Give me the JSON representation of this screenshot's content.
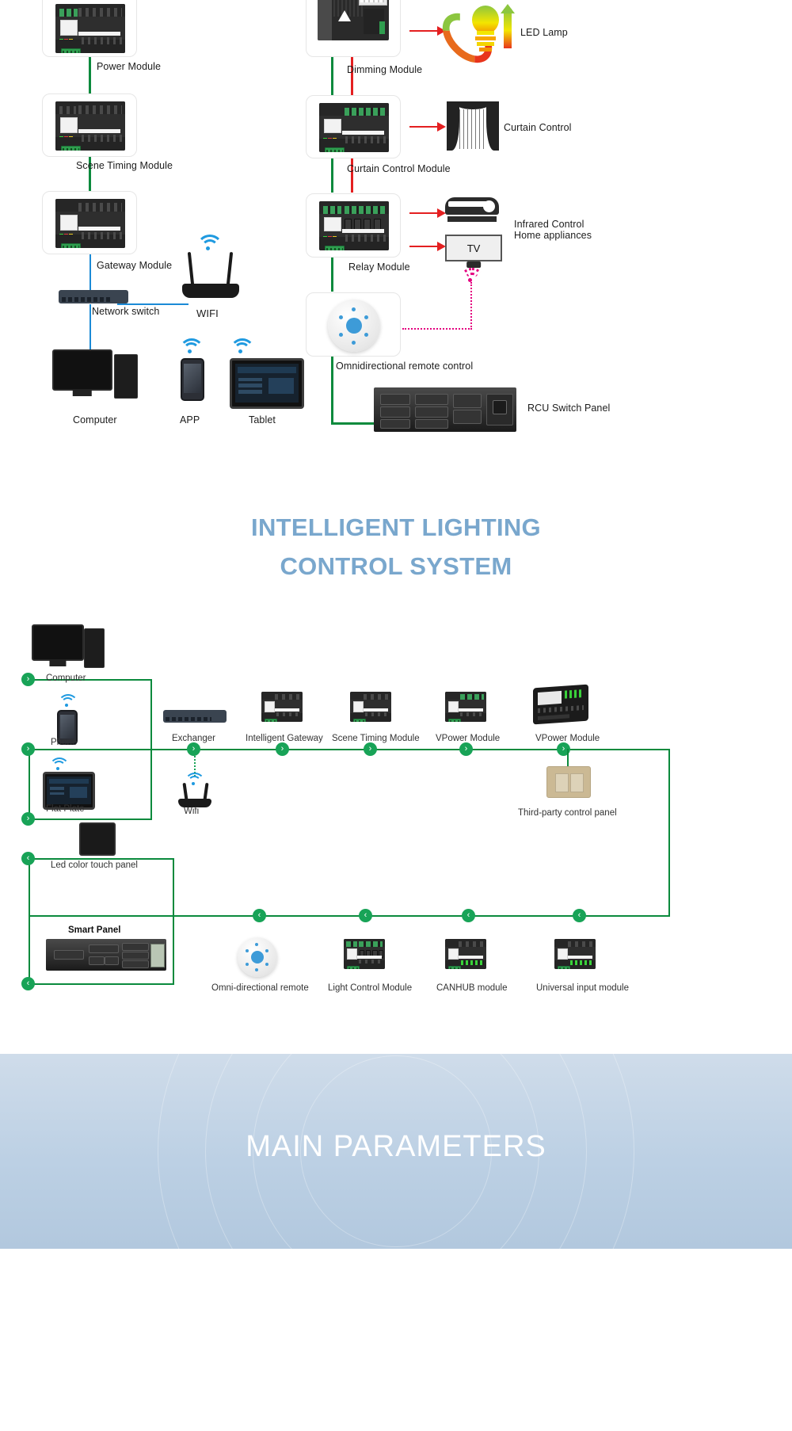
{
  "diagram_top": {
    "name": "hotel-rcu-system-topology",
    "nodes": [
      {
        "id": "power_module",
        "label": "Power Module"
      },
      {
        "id": "scene_timing_module",
        "label": "Scene Timing Module"
      },
      {
        "id": "gateway_module",
        "label": "Gateway Module"
      },
      {
        "id": "network_switch",
        "label": "Network switch"
      },
      {
        "id": "wifi",
        "label": "WIFI"
      },
      {
        "id": "computer",
        "label": "Computer"
      },
      {
        "id": "app",
        "label": "APP"
      },
      {
        "id": "tablet",
        "label": "Tablet"
      },
      {
        "id": "dimming_module",
        "label": "Dimming Module"
      },
      {
        "id": "curtain_control_module",
        "label": "Curtain Control Module"
      },
      {
        "id": "relay_module",
        "label": "Relay Module"
      },
      {
        "id": "omni_remote",
        "label": "Omnidirectional remote control"
      },
      {
        "id": "led_lamp",
        "label": "LED Lamp"
      },
      {
        "id": "curtain_control",
        "label": "Curtain Control"
      },
      {
        "id": "infrared_line1",
        "label": "Infrared Control"
      },
      {
        "id": "infrared_line2",
        "label": "Home appliances"
      },
      {
        "id": "tv",
        "label": "TV"
      },
      {
        "id": "rcu_switch_panel",
        "label": "RCU Switch Panel"
      }
    ],
    "line_colors": {
      "bus": "#0b8a3d",
      "control": "#e41f20",
      "network": "#1b8ad6",
      "ir": "#e4007f"
    }
  },
  "section_title": {
    "line1": "INTELLIGENT LIGHTING",
    "line2": "CONTROL SYSTEM",
    "color": "#79a7cd"
  },
  "diagram_bottom": {
    "name": "intelligent-lighting-control-system-topology",
    "row_inputs": [
      {
        "id": "computer",
        "label": "Computer"
      },
      {
        "id": "phone",
        "label": "Phone"
      },
      {
        "id": "flat_plate",
        "label": "Flat Plate"
      }
    ],
    "row_backbone": [
      {
        "id": "exchanger",
        "label": "Exchanger"
      },
      {
        "id": "intelligent_gateway",
        "label": "Intelligent Gateway"
      },
      {
        "id": "scene_timing_module",
        "label": "Scene Timing Module"
      },
      {
        "id": "vpower_module_1",
        "label": "VPower Module"
      },
      {
        "id": "vpower_module_2",
        "label": "VPower Module"
      }
    ],
    "row_secondary": [
      {
        "id": "wifi",
        "label": "Wifi"
      },
      {
        "id": "third_party_panel",
        "label": "Third-party control panel"
      }
    ],
    "row_panels": [
      {
        "id": "led_color_touch_panel",
        "label": "Led color touch panel"
      },
      {
        "id": "smart_panel",
        "label": "Smart Panel"
      }
    ],
    "row_modules": [
      {
        "id": "omni_directional_remote",
        "label": "Omni-directional remote"
      },
      {
        "id": "light_control_module",
        "label": "Light Control Module"
      },
      {
        "id": "canhub_module",
        "label": "CANHUB module"
      },
      {
        "id": "universal_input_module",
        "label": "Universal input module"
      }
    ],
    "line_color": "#18a357",
    "arrow_right": "›",
    "arrow_left": "‹"
  },
  "banner": {
    "title": "MAIN PARAMETERS",
    "bg_start": "#cfdcea",
    "bg_end": "#b2c8de",
    "text_color": "#ffffff"
  }
}
